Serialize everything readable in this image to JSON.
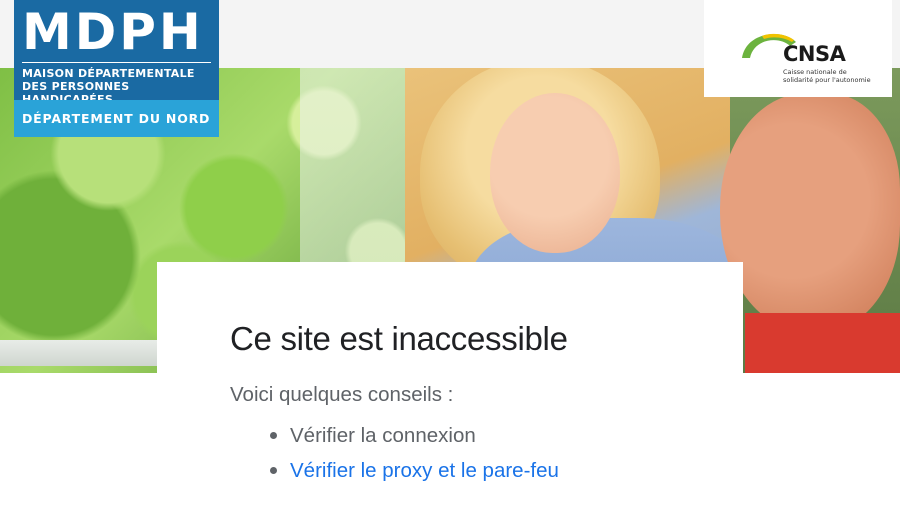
{
  "header": {
    "mdph": {
      "title": "MDPH",
      "subtitle_line1": "MAISON DÉPARTEMENTALE",
      "subtitle_line2": "DES PERSONNES HANDICAPÉES",
      "department": "DÉPARTEMENT DU NORD",
      "colors": {
        "primary": "#1a6aa3",
        "secondary": "#2aa3d8"
      }
    },
    "cnsa": {
      "name": "CNSA",
      "tagline_line1": "Caisse nationale de",
      "tagline_line2": "solidarité pour l'autonomie",
      "colors": {
        "arc_green": "#6cb33e",
        "arc_yellow": "#f2c300"
      }
    }
  },
  "error": {
    "title": "Ce site est inaccessible",
    "intro": "Voici quelques conseils :",
    "tips": [
      {
        "label": "Vérifier la connexion",
        "is_link": false
      },
      {
        "label": "Vérifier le proxy et le pare-feu",
        "is_link": true
      }
    ],
    "colors": {
      "title": "#202124",
      "text": "#5f6368",
      "link": "#1a73e8"
    }
  }
}
